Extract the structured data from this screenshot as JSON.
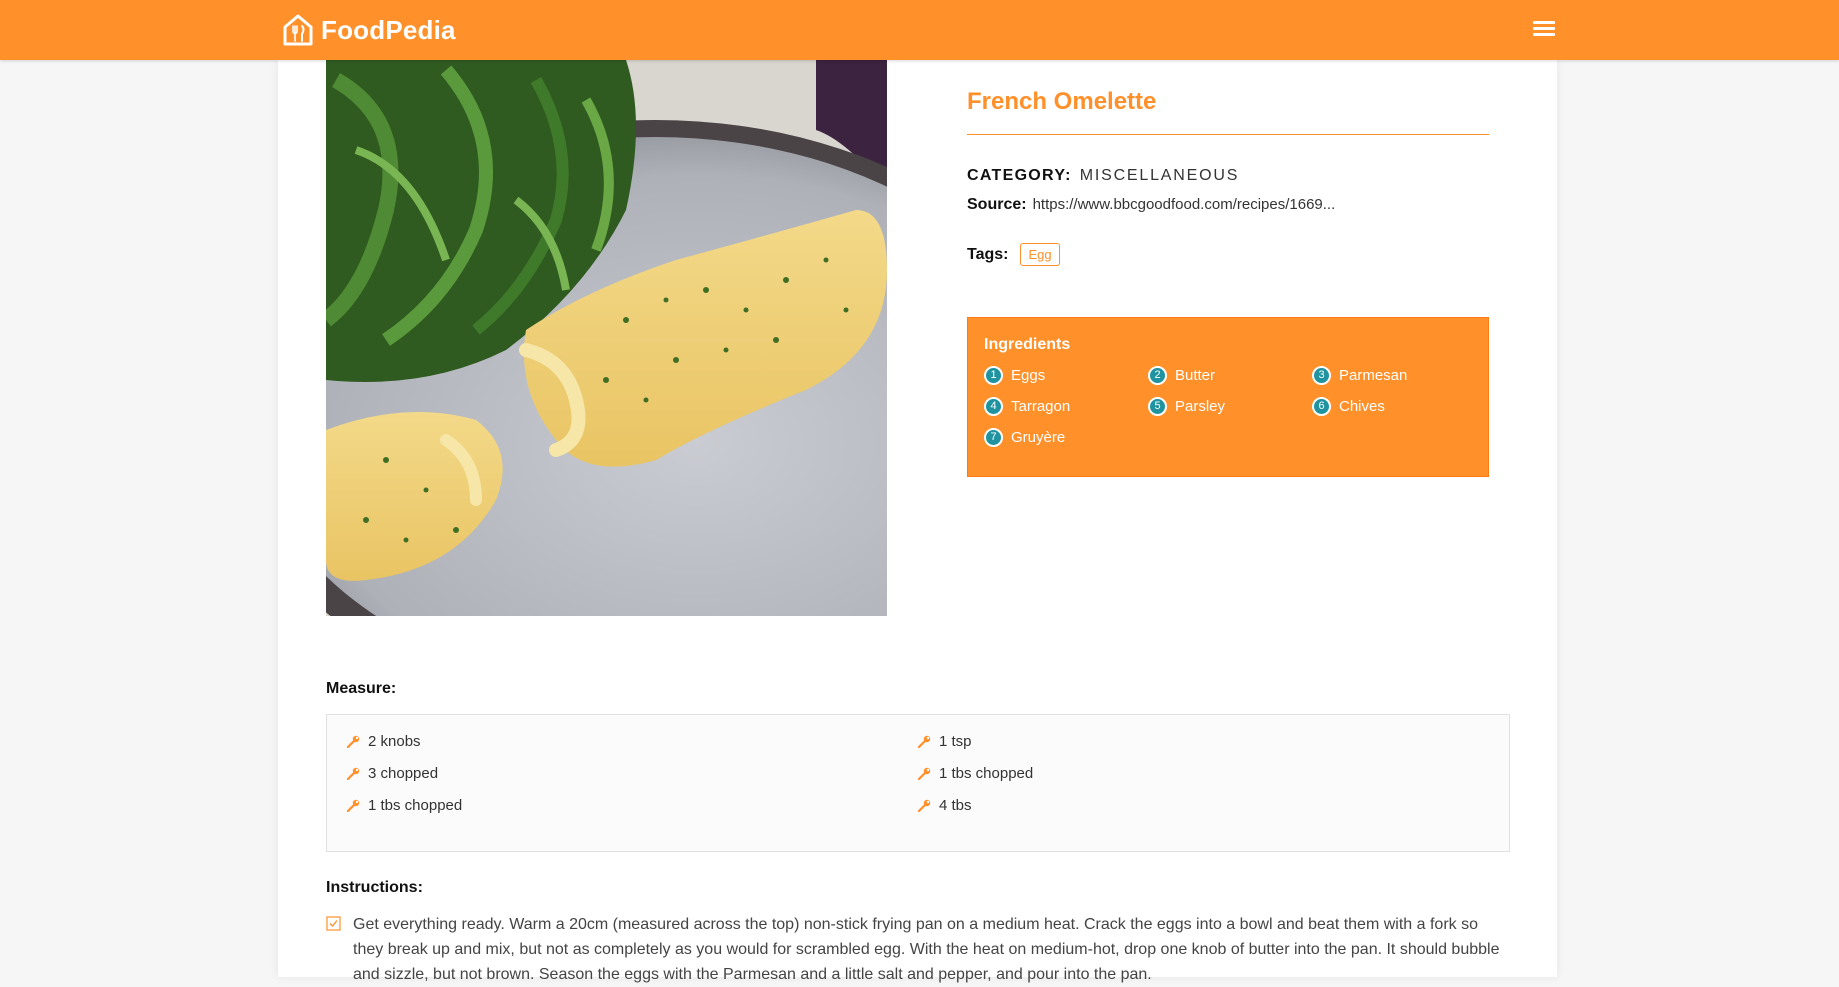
{
  "navbar": {
    "brand_name": "FoodPedia",
    "brand_icon": "house-fork-knife-icon",
    "menu_icon": "hamburger-menu-icon",
    "accent_color": "#ff902a"
  },
  "recipe": {
    "title": "French Omelette",
    "category_label": "CATEGORY:",
    "category_value": "MISCELLANEOUS",
    "source_label": "Source:",
    "source_url": "https://www.bbcgoodfood.com/recipes/1669...",
    "tags_label": "Tags:",
    "tags": [
      "Egg"
    ],
    "photo": "french-omelette-photo"
  },
  "ingredients": {
    "heading": "Ingredients",
    "badge_color": "#1f93a0",
    "items": [
      {
        "num": "1",
        "name": "Eggs"
      },
      {
        "num": "2",
        "name": "Butter"
      },
      {
        "num": "3",
        "name": "Parmesan"
      },
      {
        "num": "4",
        "name": "Tarragon"
      },
      {
        "num": "5",
        "name": "Parsley"
      },
      {
        "num": "6",
        "name": "Chives"
      },
      {
        "num": "7",
        "name": "Gruyère"
      }
    ]
  },
  "measure": {
    "heading": "Measure:",
    "icon": "wrench-icon",
    "items": [
      "2 knobs",
      "1 tsp",
      "3 chopped",
      "1 tbs chopped",
      "1 tbs chopped",
      "4 tbs"
    ]
  },
  "instructions": {
    "heading": "Instructions:",
    "icon": "checkbox-icon",
    "steps": [
      "Get everything ready. Warm a 20cm (measured across the top) non-stick frying pan on a medium heat. Crack the eggs into a bowl and beat them with a fork so they break up and mix, but not as completely as you would for scrambled egg. With the heat on medium-hot, drop one knob of butter into the pan. It should bubble and sizzle, but not brown. Season the eggs with the Parmesan and a little salt and pepper, and pour into the pan."
    ]
  }
}
